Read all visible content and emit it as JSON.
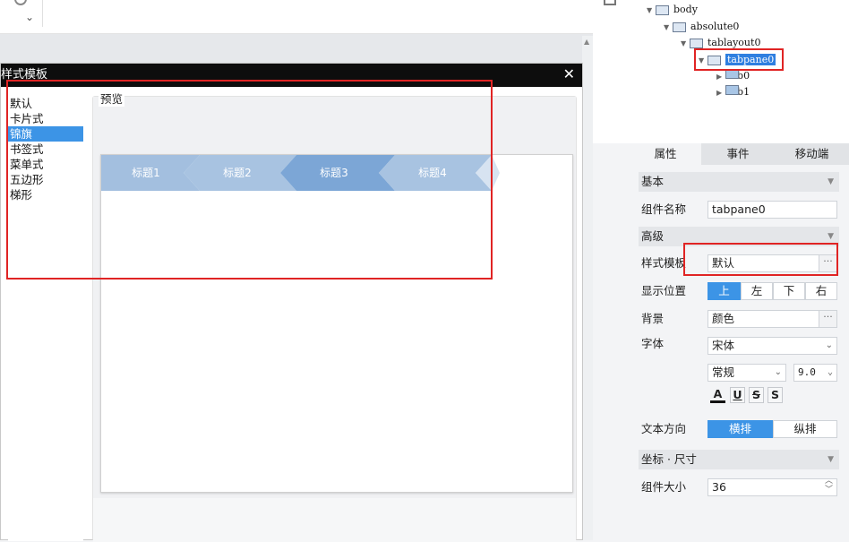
{
  "dialog": {
    "title": "样式模板",
    "close_glyph": "✕",
    "styles": [
      "默认",
      "卡片式",
      "锦旗",
      "书签式",
      "菜单式",
      "五边形",
      "梯形"
    ],
    "selected_index": 2,
    "preview_label": "预览",
    "tabs": [
      "标题1",
      "标题2",
      "标题3",
      "标题4"
    ]
  },
  "tree": {
    "nodes": [
      "body",
      "absolute0",
      "tablayout0",
      "tabpane0",
      "Tab0",
      "Tab1"
    ]
  },
  "props": {
    "tabs": [
      "属性",
      "事件",
      "移动端"
    ],
    "sections": {
      "basic": "基本",
      "advanced": "高级",
      "coord": "坐标 · 尺寸"
    },
    "component_name_label": "组件名称",
    "component_name_value": "tabpane0",
    "style_template_label": "样式模板",
    "style_template_value": "默认",
    "display_position_label": "显示位置",
    "positions": [
      "上",
      "左",
      "下",
      "右"
    ],
    "background_label": "背景",
    "background_value": "颜色",
    "font_label": "字体",
    "font_family_value": "宋体",
    "font_style_value": "常规",
    "font_size_value": "9.0",
    "format_buttons": [
      "A",
      "U",
      "S",
      "S"
    ],
    "text_direction_label": "文本方向",
    "directions": [
      "横排",
      "纵排"
    ],
    "component_size_label": "组件大小",
    "component_size_value": "36",
    "ellipsis": "···"
  },
  "colors": {
    "accent": "#3c94e6",
    "highlight": "#e02424",
    "tab_light": "#a3bfdf",
    "tab_dark": "#7ca6d6"
  }
}
